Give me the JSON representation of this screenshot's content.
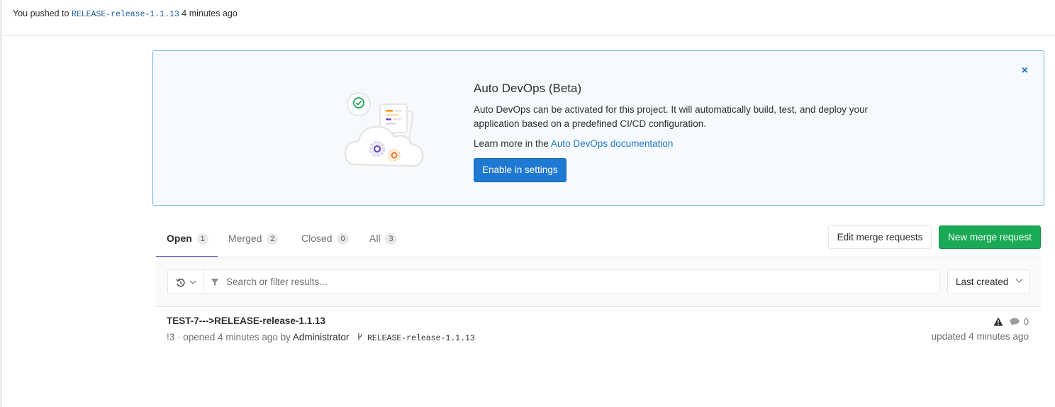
{
  "push_banner": {
    "prefix": "You pushed to",
    "branch": "RELEASE-release-1.1.13",
    "suffix": "4 minutes ago"
  },
  "auto_devops": {
    "title": "Auto DevOps (Beta)",
    "description": "Auto DevOps can be activated for this project. It will automatically build, test, and deploy your application based on a predefined CI/CD configuration.",
    "learn_prefix": "Learn more in the",
    "learn_link": "Auto DevOps documentation",
    "button": "Enable in settings",
    "close_icon": "×"
  },
  "tabs": [
    {
      "label": "Open",
      "count": "1",
      "active": true
    },
    {
      "label": "Merged",
      "count": "2",
      "active": false
    },
    {
      "label": "Closed",
      "count": "0",
      "active": false
    },
    {
      "label": "All",
      "count": "3",
      "active": false
    }
  ],
  "actions": {
    "edit": "Edit merge requests",
    "new": "New merge request"
  },
  "filter": {
    "placeholder": "Search or filter results...",
    "sort": "Last created"
  },
  "merge_requests": [
    {
      "title": "TEST-7--->RELEASE-release-1.1.13",
      "reference_meta": "!3 · opened 4 minutes ago by",
      "author": "Administrator",
      "branch": "RELEASE-release-1.1.13",
      "comments": "0",
      "updated": "updated 4 minutes ago"
    }
  ],
  "colors": {
    "primary": "#1f78d1",
    "success": "#1aaa55",
    "active_tab": "#6b4fbb",
    "banner_bg": "#f6fafe",
    "banner_border": "#73afea"
  }
}
